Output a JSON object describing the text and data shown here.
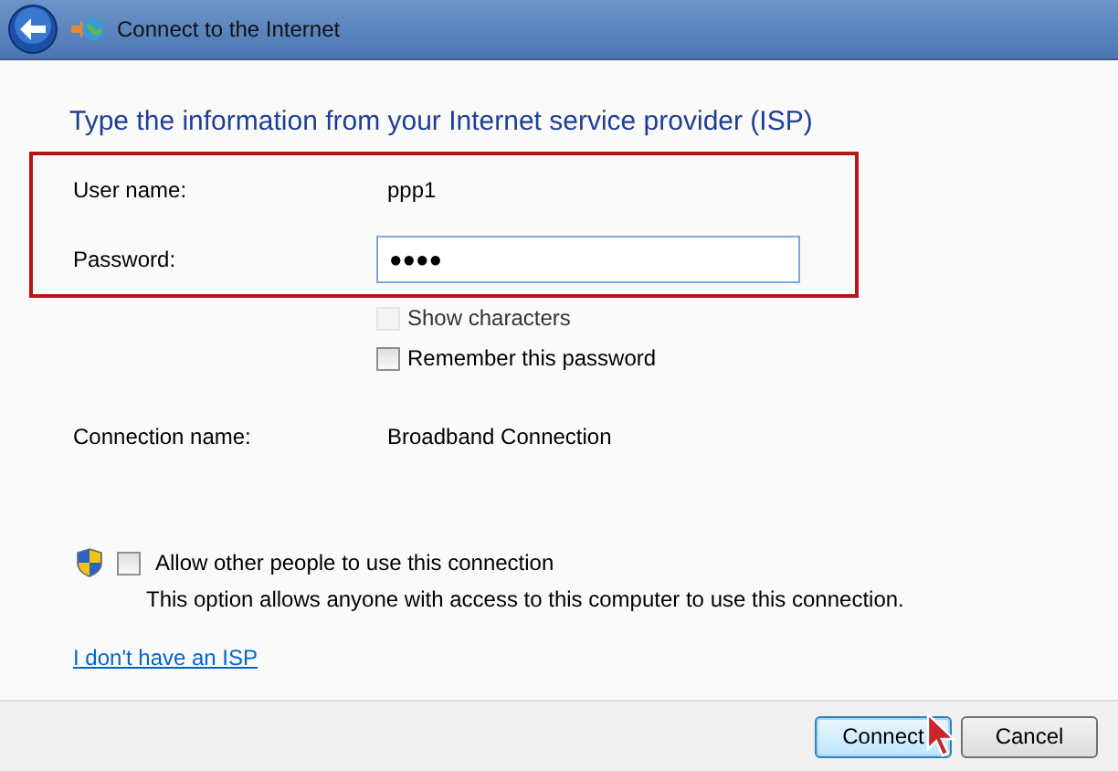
{
  "window": {
    "title": "Connect to the Internet"
  },
  "heading": "Type the information from your Internet service provider (ISP)",
  "credentials": {
    "highlighted": true,
    "fields": [
      {
        "kind": "text",
        "label": "User name:",
        "value": "ppp1"
      },
      {
        "kind": "input",
        "label": "Password:",
        "value": "●●●●"
      }
    ]
  },
  "password_options": [
    {
      "label": "Show characters",
      "checked": false,
      "disabled": true
    },
    {
      "label": "Remember this password",
      "checked": false,
      "disabled": false
    }
  ],
  "connection_name": {
    "label": "Connection name:",
    "value": "Broadband Connection"
  },
  "allow_others": {
    "label": "Allow other people to use this connection",
    "checked": false,
    "description": "This option allows anyone with access to this computer to use this connection."
  },
  "link": "I don't have an ISP",
  "buttons": [
    {
      "label": "Connect",
      "default": true
    },
    {
      "label": "Cancel",
      "default": false
    }
  ]
}
